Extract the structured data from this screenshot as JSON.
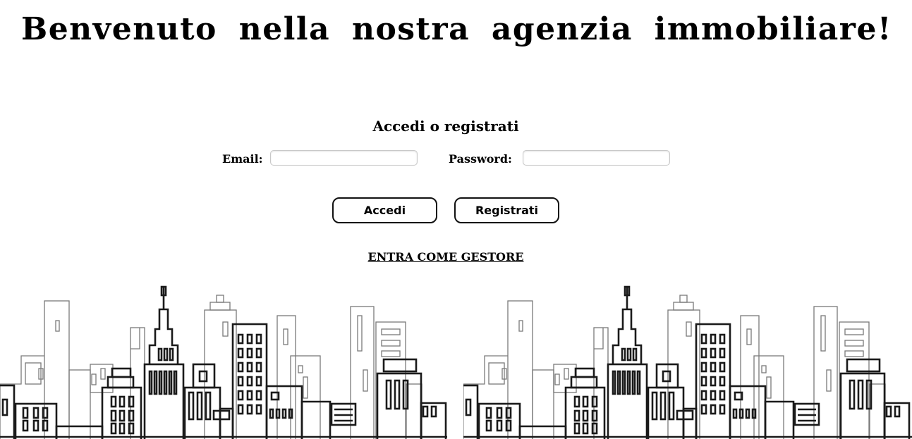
{
  "header": {
    "title": "Benvenuto nella nostra agenzia immobiliare!"
  },
  "login": {
    "heading": "Accedi o registrati",
    "email_label": "Email:",
    "email_value": "",
    "password_label": "Password:",
    "password_value": "",
    "login_button": "Accedi",
    "register_button": "Registrati",
    "manager_link": "ENTRA COME GESTORE"
  },
  "decor": {
    "skyline_image": "city-skyline-illustration",
    "skyline_count": 2
  }
}
